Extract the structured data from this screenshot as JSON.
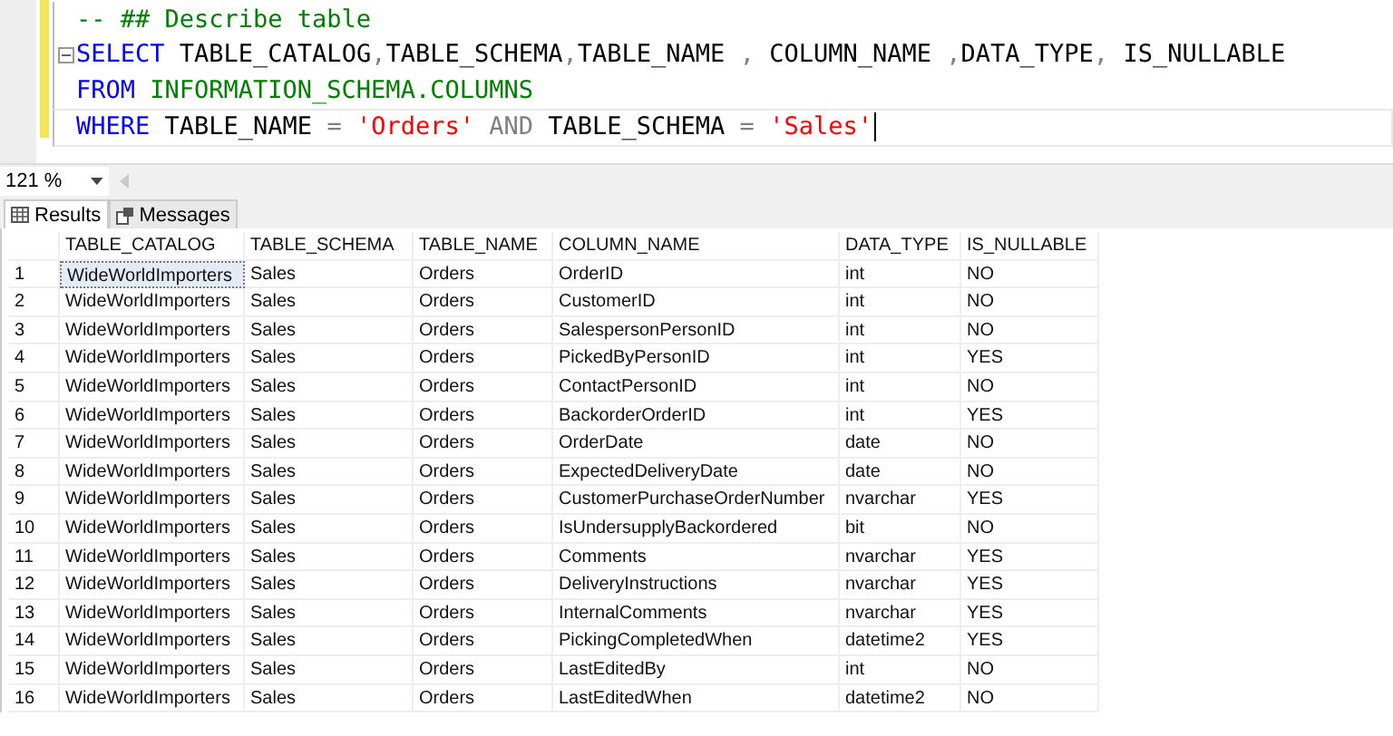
{
  "editor": {
    "lines": [
      {
        "current": false,
        "foldable": false,
        "tokens": [
          {
            "kind": "comment",
            "text": "-- ## Describe table"
          }
        ]
      },
      {
        "current": false,
        "foldable": true,
        "tokens": [
          {
            "kind": "keyword",
            "text": "SELECT"
          },
          {
            "kind": "plain",
            "text": " TABLE_CATALOG"
          },
          {
            "kind": "operator",
            "text": ","
          },
          {
            "kind": "plain",
            "text": "TABLE_SCHEMA"
          },
          {
            "kind": "operator",
            "text": ","
          },
          {
            "kind": "plain",
            "text": "TABLE_NAME "
          },
          {
            "kind": "operator",
            "text": ","
          },
          {
            "kind": "plain",
            "text": " COLUMN_NAME "
          },
          {
            "kind": "operator",
            "text": ","
          },
          {
            "kind": "plain",
            "text": "DATA_TYPE"
          },
          {
            "kind": "operator",
            "text": ","
          },
          {
            "kind": "plain",
            "text": " IS_NULLABLE"
          }
        ]
      },
      {
        "current": false,
        "foldable": false,
        "tokens": [
          {
            "kind": "keyword",
            "text": "FROM"
          },
          {
            "kind": "system",
            "text": " INFORMATION_SCHEMA.COLUMNS"
          }
        ]
      },
      {
        "current": true,
        "foldable": false,
        "tokens": [
          {
            "kind": "keyword",
            "text": "WHERE"
          },
          {
            "kind": "plain",
            "text": " TABLE_NAME "
          },
          {
            "kind": "operator",
            "text": "="
          },
          {
            "kind": "string",
            "text": " 'Orders'"
          },
          {
            "kind": "operator",
            "text": " AND"
          },
          {
            "kind": "plain",
            "text": " TABLE_SCHEMA "
          },
          {
            "kind": "operator",
            "text": "="
          },
          {
            "kind": "string",
            "text": " 'Sales'"
          }
        ]
      }
    ]
  },
  "zoom": {
    "value": "121 %"
  },
  "tabs": [
    {
      "label": "Results",
      "selected": true
    },
    {
      "label": "Messages",
      "selected": false
    }
  ],
  "table": {
    "columns": [
      "TABLE_CATALOG",
      "TABLE_SCHEMA",
      "TABLE_NAME",
      "COLUMN_NAME",
      "DATA_TYPE",
      "IS_NULLABLE"
    ],
    "rows": [
      {
        "number": "1",
        "selected": true,
        "cells": [
          "WideWorldImporters",
          "Sales",
          "Orders",
          "OrderID",
          "int",
          "NO"
        ]
      },
      {
        "number": "2",
        "selected": false,
        "cells": [
          "WideWorldImporters",
          "Sales",
          "Orders",
          "CustomerID",
          "int",
          "NO"
        ]
      },
      {
        "number": "3",
        "selected": false,
        "cells": [
          "WideWorldImporters",
          "Sales",
          "Orders",
          "SalespersonPersonID",
          "int",
          "NO"
        ]
      },
      {
        "number": "4",
        "selected": false,
        "cells": [
          "WideWorldImporters",
          "Sales",
          "Orders",
          "PickedByPersonID",
          "int",
          "YES"
        ]
      },
      {
        "number": "5",
        "selected": false,
        "cells": [
          "WideWorldImporters",
          "Sales",
          "Orders",
          "ContactPersonID",
          "int",
          "NO"
        ]
      },
      {
        "number": "6",
        "selected": false,
        "cells": [
          "WideWorldImporters",
          "Sales",
          "Orders",
          "BackorderOrderID",
          "int",
          "YES"
        ]
      },
      {
        "number": "7",
        "selected": false,
        "cells": [
          "WideWorldImporters",
          "Sales",
          "Orders",
          "OrderDate",
          "date",
          "NO"
        ]
      },
      {
        "number": "8",
        "selected": false,
        "cells": [
          "WideWorldImporters",
          "Sales",
          "Orders",
          "ExpectedDeliveryDate",
          "date",
          "NO"
        ]
      },
      {
        "number": "9",
        "selected": false,
        "cells": [
          "WideWorldImporters",
          "Sales",
          "Orders",
          "CustomerPurchaseOrderNumber",
          "nvarchar",
          "YES"
        ]
      },
      {
        "number": "10",
        "selected": false,
        "cells": [
          "WideWorldImporters",
          "Sales",
          "Orders",
          "IsUndersupplyBackordered",
          "bit",
          "NO"
        ]
      },
      {
        "number": "11",
        "selected": false,
        "cells": [
          "WideWorldImporters",
          "Sales",
          "Orders",
          "Comments",
          "nvarchar",
          "YES"
        ]
      },
      {
        "number": "12",
        "selected": false,
        "cells": [
          "WideWorldImporters",
          "Sales",
          "Orders",
          "DeliveryInstructions",
          "nvarchar",
          "YES"
        ]
      },
      {
        "number": "13",
        "selected": false,
        "cells": [
          "WideWorldImporters",
          "Sales",
          "Orders",
          "InternalComments",
          "nvarchar",
          "YES"
        ]
      },
      {
        "number": "14",
        "selected": false,
        "cells": [
          "WideWorldImporters",
          "Sales",
          "Orders",
          "PickingCompletedWhen",
          "datetime2",
          "YES"
        ]
      },
      {
        "number": "15",
        "selected": false,
        "cells": [
          "WideWorldImporters",
          "Sales",
          "Orders",
          "LastEditedBy",
          "int",
          "NO"
        ]
      },
      {
        "number": "16",
        "selected": false,
        "cells": [
          "WideWorldImporters",
          "Sales",
          "Orders",
          "LastEditedWhen",
          "datetime2",
          "NO"
        ]
      }
    ]
  }
}
